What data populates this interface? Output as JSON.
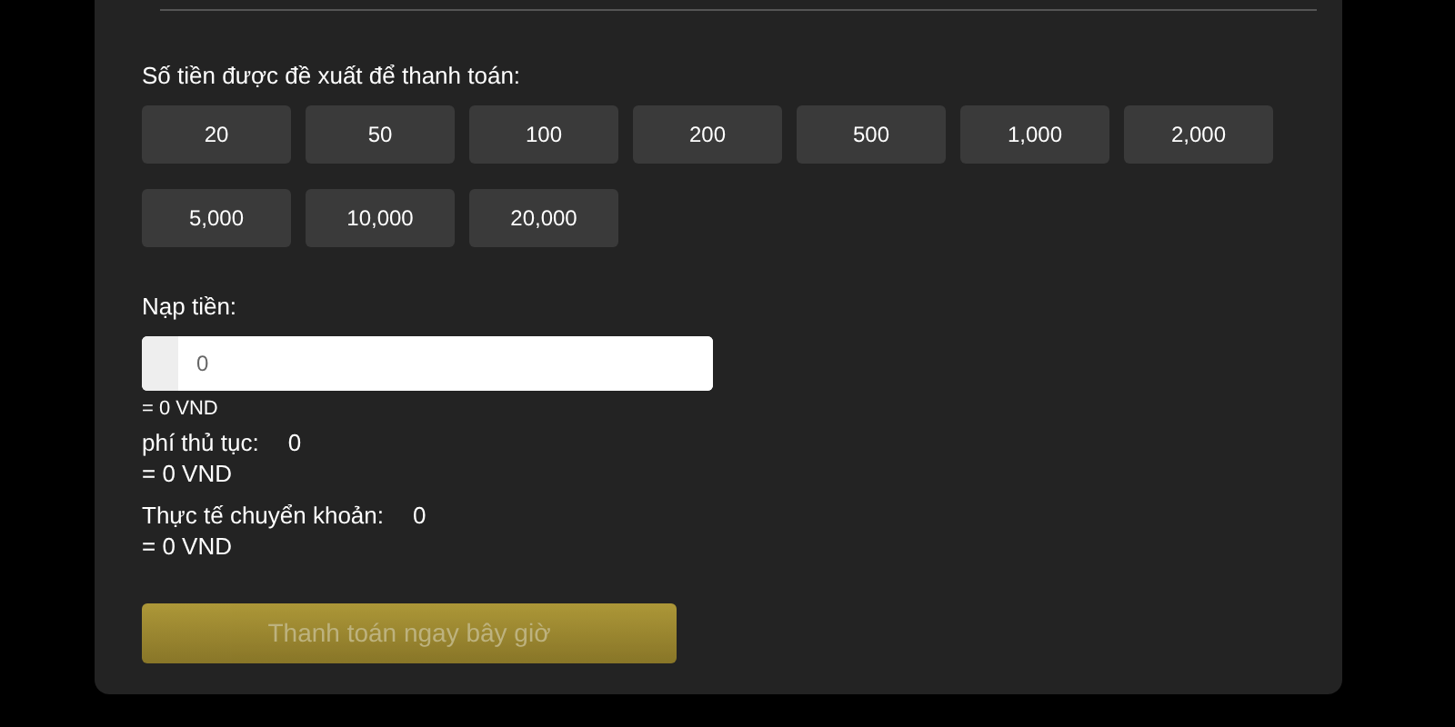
{
  "suggested": {
    "label": "Số tiền được đề xuất để thanh toán:",
    "amounts": [
      "20",
      "50",
      "100",
      "200",
      "500",
      "1,000",
      "2,000",
      "5,000",
      "10,000",
      "20,000"
    ]
  },
  "deposit": {
    "label": "Nạp tiền:",
    "value": "0",
    "converted": "= 0 VND"
  },
  "fee": {
    "label": "phí thủ tục:",
    "value": "0",
    "converted": "= 0 VND"
  },
  "actual": {
    "label": "Thực tế chuyển khoản:",
    "value": "0",
    "converted": "= 0 VND"
  },
  "pay_button": {
    "label": "Thanh toán ngay bây giờ",
    "disabled": true
  }
}
